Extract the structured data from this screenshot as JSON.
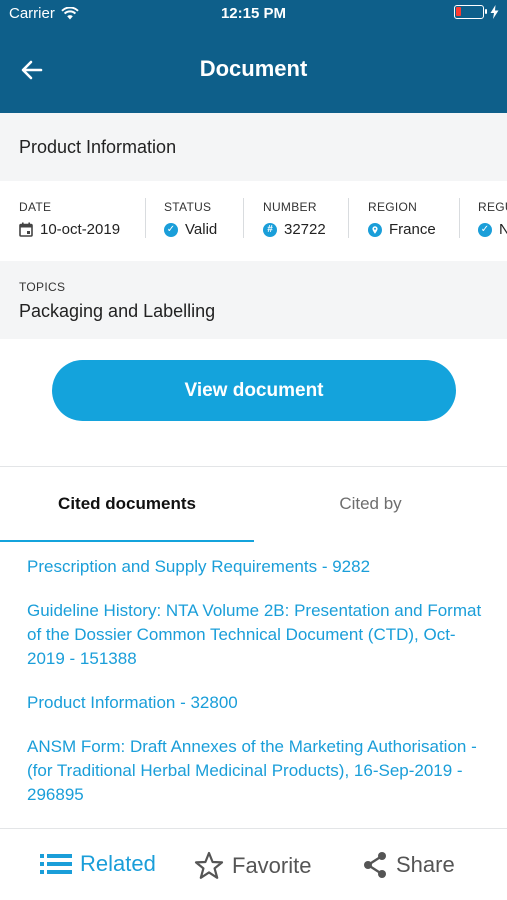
{
  "status_bar": {
    "carrier": "Carrier",
    "time": "12:15 PM",
    "battery_level": 0.18
  },
  "nav": {
    "title": "Document",
    "back_icon": "arrow-left-icon"
  },
  "document": {
    "title": "Product Information"
  },
  "meta": [
    {
      "label": "DATE",
      "value": "10-oct-2019",
      "icon": "calendar-icon"
    },
    {
      "label": "STATUS",
      "value": "Valid",
      "icon": "check-circle-icon"
    },
    {
      "label": "NUMBER",
      "value": "32722",
      "icon": "hash-circle-icon"
    },
    {
      "label": "REGION",
      "value": "France",
      "icon": "location-pin-icon"
    },
    {
      "label": "REGU",
      "value": "N",
      "icon": "check-circle-icon"
    }
  ],
  "topics": {
    "label": "TOPICS",
    "value": "Packaging and Labelling"
  },
  "view_button": {
    "label": "View document"
  },
  "tabs": [
    {
      "label": "Cited documents",
      "active": true
    },
    {
      "label": "Cited by",
      "active": false
    }
  ],
  "cited_documents": [
    "Prescription and Supply Requirements - 9282",
    "Guideline History: NTA Volume 2B: Presentation and Format of the Dossier Common Technical Document (CTD), Oct-2019 - 151388",
    "Product Information - 32800",
    "ANSM Form: Draft Annexes of the Marketing Authorisation - (for Traditional Herbal Medicinal Products), 16-Sep-2019 - 296895"
  ],
  "toolbar": {
    "related_label": "Related",
    "favorite_label": "Favorite",
    "share_label": "Share"
  },
  "colors": {
    "header": "#0e5f8a",
    "accent": "#14a3dc",
    "link": "#1a9ed9",
    "section_bg": "#f4f5f6"
  }
}
